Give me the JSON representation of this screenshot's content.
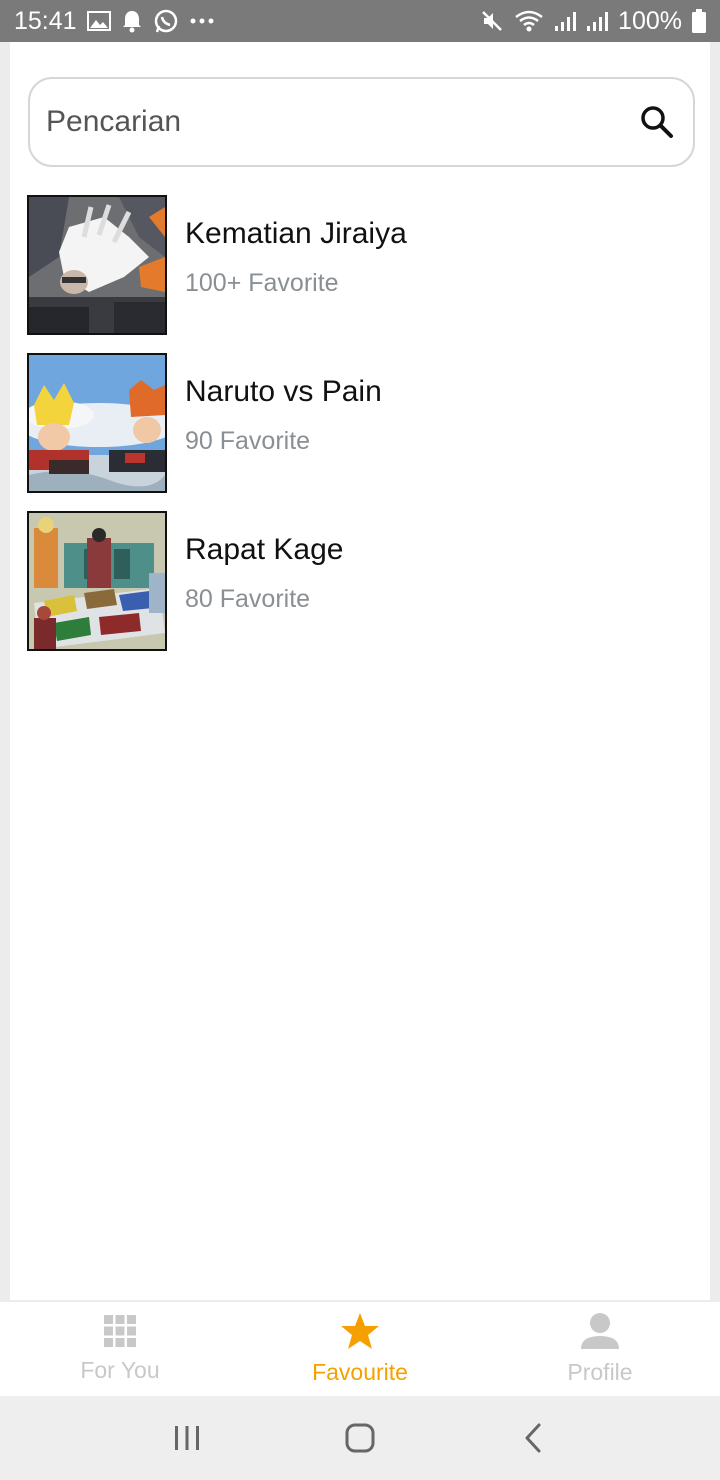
{
  "status_bar": {
    "time": "15:41",
    "battery": "100%",
    "left_icons": [
      "gallery-icon",
      "bell-icon",
      "whatsapp-icon",
      "more-dots-icon"
    ],
    "right_icons": [
      "mute-icon",
      "wifi-icon",
      "signal-icon",
      "signal-icon",
      "battery-icon"
    ]
  },
  "search": {
    "placeholder": "Pencarian",
    "icon": "search-icon"
  },
  "favourites": [
    {
      "title": "Kematian Jiraiya",
      "count": "100+ Favorite"
    },
    {
      "title": "Naruto vs Pain",
      "count": "90 Favorite"
    },
    {
      "title": "Rapat Kage",
      "count": "80 Favorite"
    }
  ],
  "bottom_nav": {
    "items": [
      {
        "label": "For You",
        "icon": "grid-icon",
        "active": false
      },
      {
        "label": "Favourite",
        "icon": "star-icon",
        "active": true
      },
      {
        "label": "Profile",
        "icon": "person-icon",
        "active": false
      }
    ],
    "colors": {
      "active": "#f5a000",
      "inactive": "#c8c8c8"
    }
  },
  "system_nav": [
    "recent-apps-icon",
    "home-icon",
    "back-icon"
  ]
}
